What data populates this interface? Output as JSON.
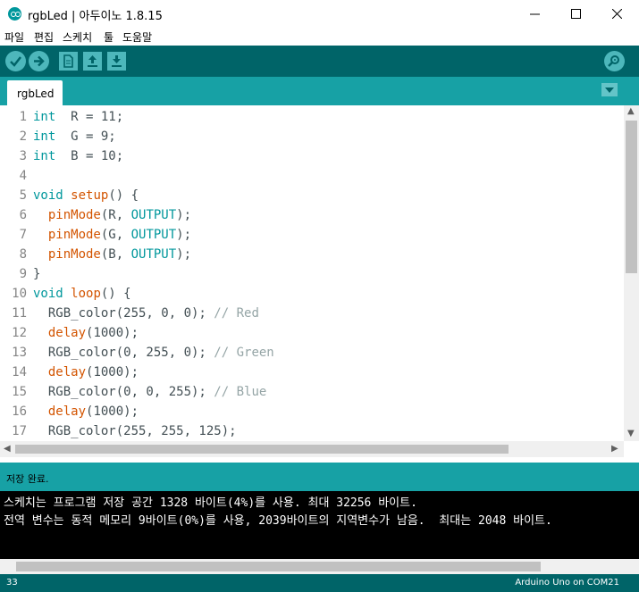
{
  "window": {
    "title": "rgbLed | 아두이노 1.8.15",
    "controls": {
      "minimize": "minimize",
      "maximize": "maximize",
      "close": "close"
    }
  },
  "menu": {
    "items": [
      "파일",
      "편집",
      "스케치",
      "툴",
      "도움말"
    ]
  },
  "toolbar": {
    "buttons": [
      "verify-icon",
      "upload-icon",
      "new-icon",
      "open-icon",
      "save-icon"
    ],
    "right_button": "serial-monitor-icon"
  },
  "tabs": {
    "active": "rgbLed"
  },
  "editor": {
    "lines": [
      {
        "n": "1",
        "tokens": [
          [
            "kw",
            "int"
          ],
          [
            "",
            "  R = 11;"
          ]
        ]
      },
      {
        "n": "2",
        "tokens": [
          [
            "kw",
            "int"
          ],
          [
            "",
            "  G = 9;"
          ]
        ]
      },
      {
        "n": "3",
        "tokens": [
          [
            "kw",
            "int"
          ],
          [
            "",
            "  B = 10;"
          ]
        ]
      },
      {
        "n": "4",
        "tokens": []
      },
      {
        "n": "5",
        "tokens": [
          [
            "kw",
            "void"
          ],
          [
            "",
            " "
          ],
          [
            "fn",
            "setup"
          ],
          [
            "",
            "() {"
          ]
        ]
      },
      {
        "n": "6",
        "tokens": [
          [
            "",
            "  "
          ],
          [
            "fn",
            "pinMode"
          ],
          [
            "",
            "(R, "
          ],
          [
            "kw",
            "OUTPUT"
          ],
          [
            "",
            ");"
          ]
        ]
      },
      {
        "n": "7",
        "tokens": [
          [
            "",
            "  "
          ],
          [
            "fn",
            "pinMode"
          ],
          [
            "",
            "(G, "
          ],
          [
            "kw",
            "OUTPUT"
          ],
          [
            "",
            ");"
          ]
        ]
      },
      {
        "n": "8",
        "tokens": [
          [
            "",
            "  "
          ],
          [
            "fn",
            "pinMode"
          ],
          [
            "",
            "(B, "
          ],
          [
            "kw",
            "OUTPUT"
          ],
          [
            "",
            ");"
          ]
        ]
      },
      {
        "n": "9",
        "tokens": [
          [
            "",
            "}"
          ]
        ]
      },
      {
        "n": "10",
        "tokens": [
          [
            "kw",
            "void"
          ],
          [
            "",
            " "
          ],
          [
            "fn",
            "loop"
          ],
          [
            "",
            "() {"
          ]
        ]
      },
      {
        "n": "11",
        "tokens": [
          [
            "",
            "  RGB_color(255, 0, 0); "
          ],
          [
            "cm",
            "// Red"
          ]
        ]
      },
      {
        "n": "12",
        "tokens": [
          [
            "",
            "  "
          ],
          [
            "fn",
            "delay"
          ],
          [
            "",
            "(1000);"
          ]
        ]
      },
      {
        "n": "13",
        "tokens": [
          [
            "",
            "  RGB_color(0, 255, 0); "
          ],
          [
            "cm",
            "// Green"
          ]
        ]
      },
      {
        "n": "14",
        "tokens": [
          [
            "",
            "  "
          ],
          [
            "fn",
            "delay"
          ],
          [
            "",
            "(1000);"
          ]
        ]
      },
      {
        "n": "15",
        "tokens": [
          [
            "",
            "  RGB_color(0, 0, 255); "
          ],
          [
            "cm",
            "// Blue"
          ]
        ]
      },
      {
        "n": "16",
        "tokens": [
          [
            "",
            "  "
          ],
          [
            "fn",
            "delay"
          ],
          [
            "",
            "(1000);"
          ]
        ]
      },
      {
        "n": "17",
        "tokens": [
          [
            "",
            "  RGB_color(255, 255, 125);"
          ]
        ]
      }
    ]
  },
  "status": {
    "message": "저장 완료."
  },
  "console": {
    "lines": [
      "스케치는 프로그램 저장 공간 1328 바이트(4%)를 사용. 최대 32256 바이트.",
      "전역 변수는 동적 메모리 9바이트(0%)를 사용, 2039바이트의 지역변수가 남음.  최대는 2048 바이트."
    ]
  },
  "footer": {
    "line_number": "33",
    "board": "Arduino Uno on COM21"
  },
  "colors": {
    "toolbar": "#006468",
    "tabbar": "#17a1a5",
    "keyword": "#00979c",
    "function": "#d35400",
    "comment": "#95a5a6"
  }
}
